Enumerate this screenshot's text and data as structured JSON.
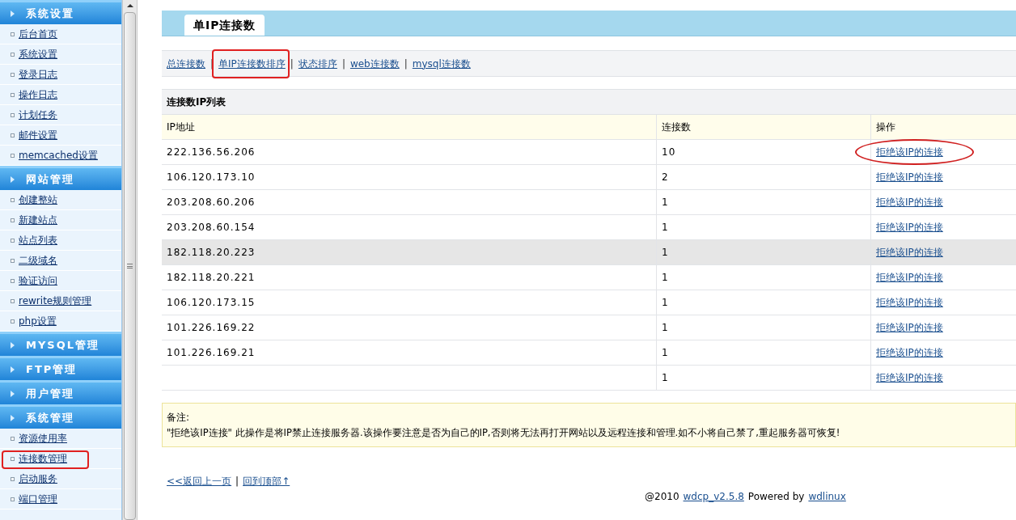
{
  "sidebar": {
    "sections": [
      {
        "title": "系统设置",
        "items": [
          {
            "label": "后台首页",
            "annotated": false
          },
          {
            "label": "系统设置",
            "annotated": false
          },
          {
            "label": "登录日志",
            "annotated": false
          },
          {
            "label": "操作日志",
            "annotated": false
          },
          {
            "label": "计划任务",
            "annotated": false
          },
          {
            "label": "邮件设置",
            "annotated": false
          },
          {
            "label": "memcached设置",
            "annotated": false
          }
        ]
      },
      {
        "title": "网站管理",
        "items": [
          {
            "label": "创建整站",
            "annotated": false
          },
          {
            "label": "新建站点",
            "annotated": false
          },
          {
            "label": "站点列表",
            "annotated": false
          },
          {
            "label": "二级域名",
            "annotated": false
          },
          {
            "label": "验证访问",
            "annotated": false
          },
          {
            "label": "rewrite规则管理",
            "annotated": false
          },
          {
            "label": "php设置",
            "annotated": false
          }
        ]
      },
      {
        "title": "MYSQL管理"
      },
      {
        "title": "FTP管理"
      },
      {
        "title": "用户管理"
      },
      {
        "title": "系统管理",
        "items": [
          {
            "label": "资源使用率",
            "annotated": false
          },
          {
            "label": "连接数管理",
            "annotated": true
          },
          {
            "label": "启动服务",
            "annotated": false
          },
          {
            "label": "端口管理",
            "annotated": false
          }
        ]
      }
    ]
  },
  "separator": "|",
  "page_tab": "单IP连接数",
  "nav_links": [
    {
      "label": "总连接数",
      "annotated": false
    },
    {
      "label": "单IP连接数排序",
      "annotated": true
    },
    {
      "label": "状态排序",
      "annotated": false
    },
    {
      "label": "web连接数",
      "annotated": false
    },
    {
      "label": "mysql连接数",
      "annotated": false
    }
  ],
  "table": {
    "title": "连接数IP列表",
    "columns": [
      "IP地址",
      "连接数",
      "操作"
    ],
    "rows": [
      {
        "ip": "222.136.56.206",
        "count": "10",
        "action": "拒绝该IP的连接",
        "highlighted": false,
        "annotated": true
      },
      {
        "ip": "106.120.173.10",
        "count": "2",
        "action": "拒绝该IP的连接",
        "highlighted": false,
        "annotated": false
      },
      {
        "ip": "203.208.60.206",
        "count": "1",
        "action": "拒绝该IP的连接",
        "highlighted": false,
        "annotated": false
      },
      {
        "ip": "203.208.60.154",
        "count": "1",
        "action": "拒绝该IP的连接",
        "highlighted": false,
        "annotated": false
      },
      {
        "ip": "182.118.20.223",
        "count": "1",
        "action": "拒绝该IP的连接",
        "highlighted": true,
        "annotated": false
      },
      {
        "ip": "182.118.20.221",
        "count": "1",
        "action": "拒绝该IP的连接",
        "highlighted": false,
        "annotated": false
      },
      {
        "ip": "106.120.173.15",
        "count": "1",
        "action": "拒绝该IP的连接",
        "highlighted": false,
        "annotated": false
      },
      {
        "ip": "101.226.169.22",
        "count": "1",
        "action": "拒绝该IP的连接",
        "highlighted": false,
        "annotated": false
      },
      {
        "ip": "101.226.169.21",
        "count": "1",
        "action": "拒绝该IP的连接",
        "highlighted": false,
        "annotated": false
      },
      {
        "count": "1",
        "action": "拒绝该IP的连接",
        "highlighted": false,
        "annotated": false
      }
    ]
  },
  "note": {
    "title": "备注:",
    "text": "\"拒绝该IP连接\" 此操作是将IP禁止连接服务器.该操作要注意是否为自己的IP,否则将无法再打开网站以及远程连接和管理.如不小将自己禁了,重起服务器可恢复!"
  },
  "footer_links": [
    "<<返回上一页",
    "回到顶部↑"
  ],
  "powered": {
    "prefix": "@2010",
    "product": "wdcp_v2.5.8",
    "middle": "Powered by",
    "vendor": "wdlinux"
  }
}
